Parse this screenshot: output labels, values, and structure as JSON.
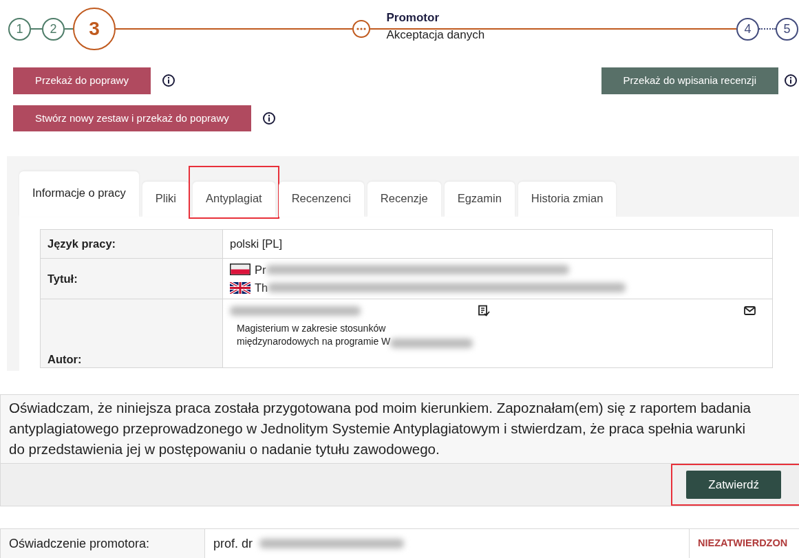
{
  "stepper": {
    "steps": [
      {
        "kind": "number",
        "label": "1",
        "color": "#4e7d69",
        "dotted_next": false
      },
      {
        "kind": "number",
        "label": "2",
        "color": "#4e7d69",
        "dotted_next": false
      },
      {
        "kind": "current",
        "label": "3",
        "color": "#c05a1e",
        "dotted_next": false
      },
      {
        "kind": "more",
        "color": "#c05a1e",
        "dotted_next": false,
        "title": "Promotor",
        "subtitle": "Akceptacja danych"
      },
      {
        "kind": "number",
        "label": "4",
        "color": "#424b7c",
        "dotted_next": true
      },
      {
        "kind": "number",
        "label": "5",
        "color": "#424b7c"
      }
    ]
  },
  "actions": {
    "left": [
      {
        "label": "Przekaż do poprawy",
        "kind": "danger"
      },
      {
        "label": "Stwórz nowy zestaw i przekaż do poprawy",
        "kind": "danger"
      }
    ],
    "right": [
      {
        "label": "Przekaż do wpisania recenzji",
        "kind": "secondary"
      }
    ]
  },
  "tabs": [
    {
      "label": "Informacje o pracy",
      "selected": true,
      "highlighted": false
    },
    {
      "label": "Pliki",
      "selected": false,
      "highlighted": false
    },
    {
      "label": "Antyplagiat",
      "selected": false,
      "highlighted": true
    },
    {
      "label": "Recenzenci",
      "selected": false,
      "highlighted": false
    },
    {
      "label": "Recenzje",
      "selected": false,
      "highlighted": false
    },
    {
      "label": "Egzamin",
      "selected": false,
      "highlighted": false
    },
    {
      "label": "Historia zmian",
      "selected": false,
      "highlighted": false
    }
  ],
  "info_table": {
    "rows": [
      {
        "kind": "text",
        "label": "Język pracy:",
        "value": "polski [PL]"
      },
      {
        "kind": "titles",
        "label": "Tytuł:",
        "titles": [
          {
            "kind": "polish",
            "text": "Pr"
          },
          {
            "kind": "english",
            "text": "Th"
          }
        ]
      },
      {
        "kind": "author",
        "label": "Autor:",
        "programme": "Magisterium w zakresie stosunków\nmiędzynarodowych na programie W"
      }
    ]
  },
  "statement": {
    "text": "Oświadczam, że niniejsza praca została przygotowana pod moim kierunkiem. Zapoznałam(em) się z raportem badania\nantyplagiatowego przeprowadzonego w Jednolitym Systemie Antyplagiatowym i stwierdzam, że praca spełnia warunki\ndo przedstawienia jej w postępowaniu o nadanie tytułu zawodowego.",
    "button": {
      "label": "Zatwierdź",
      "highlighted": true
    }
  },
  "approval": {
    "label": "Oświadczenie promotora:",
    "value": "prof. dr",
    "status": "NIEZATWIERDZON"
  }
}
